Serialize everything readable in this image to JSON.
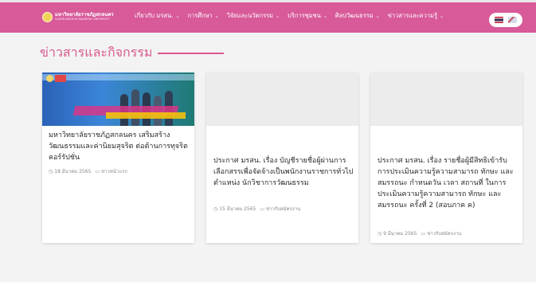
{
  "nav": {
    "logo_text": "มหาวิทยาลัยราชภัฏสกลนคร",
    "logo_subtext": "SAKON NAKHON RAJABHAT UNIVERSITY",
    "menu": [
      {
        "label": "เกี่ยวกับ มรสน."
      },
      {
        "label": "การศึกษา"
      },
      {
        "label": "วิจัยและนวัตกรรม"
      },
      {
        "label": "บริการชุมชน"
      },
      {
        "label": "ศิลปวัฒนธรรม"
      },
      {
        "label": "ข่าวสารและความรู้"
      }
    ],
    "chevron_icon": "chevron-down-icon"
  },
  "section": {
    "title": "ข่าวสารและกิจกรรม"
  },
  "cards": [
    {
      "title": "มหาวิทยาลัยราชภัฏสกลนคร เสริมสร้างวัฒนธรรมและค่านิยมสุจริต ต่อต้านการทุจริตคอร์รัปชั่น",
      "date": "18 มีนาคม 2565",
      "category": "ข่าวหน้าแรก"
    },
    {
      "title": "ประกาศ มรสน. เรื่อง บัญชีรายชื่อผู้ผ่านการเลือกสรรเพื่อจัดจ้างเป็นพนักงานราชการทั่วไป ตำแหน่ง นักวิชาการวัฒนธรรม",
      "date": "15 มีนาคม 2565",
      "category": "ข่าวรับสมัครงาน"
    },
    {
      "title": "ประกาศ มรสน. เรื่อง รายชื่อผู้มีสิทธิเข้ารับการประเมินความรู้ความสามารถ ทักษะ และสมรรถนะ กำหนดวัน เวลา สถานที่ ในการประเมินความรู้ความสามารถ ทักษะ และสมรรถนะ ครั้งที่ 2 (สอบภาค ค)",
      "date": "9 มีนาคม 2565",
      "category": "ข่าวรับสมัครงาน"
    }
  ],
  "colors": {
    "nav_bg": "#d85a99",
    "heading": "#d8588f",
    "page_bg": "#f3f3f3"
  }
}
